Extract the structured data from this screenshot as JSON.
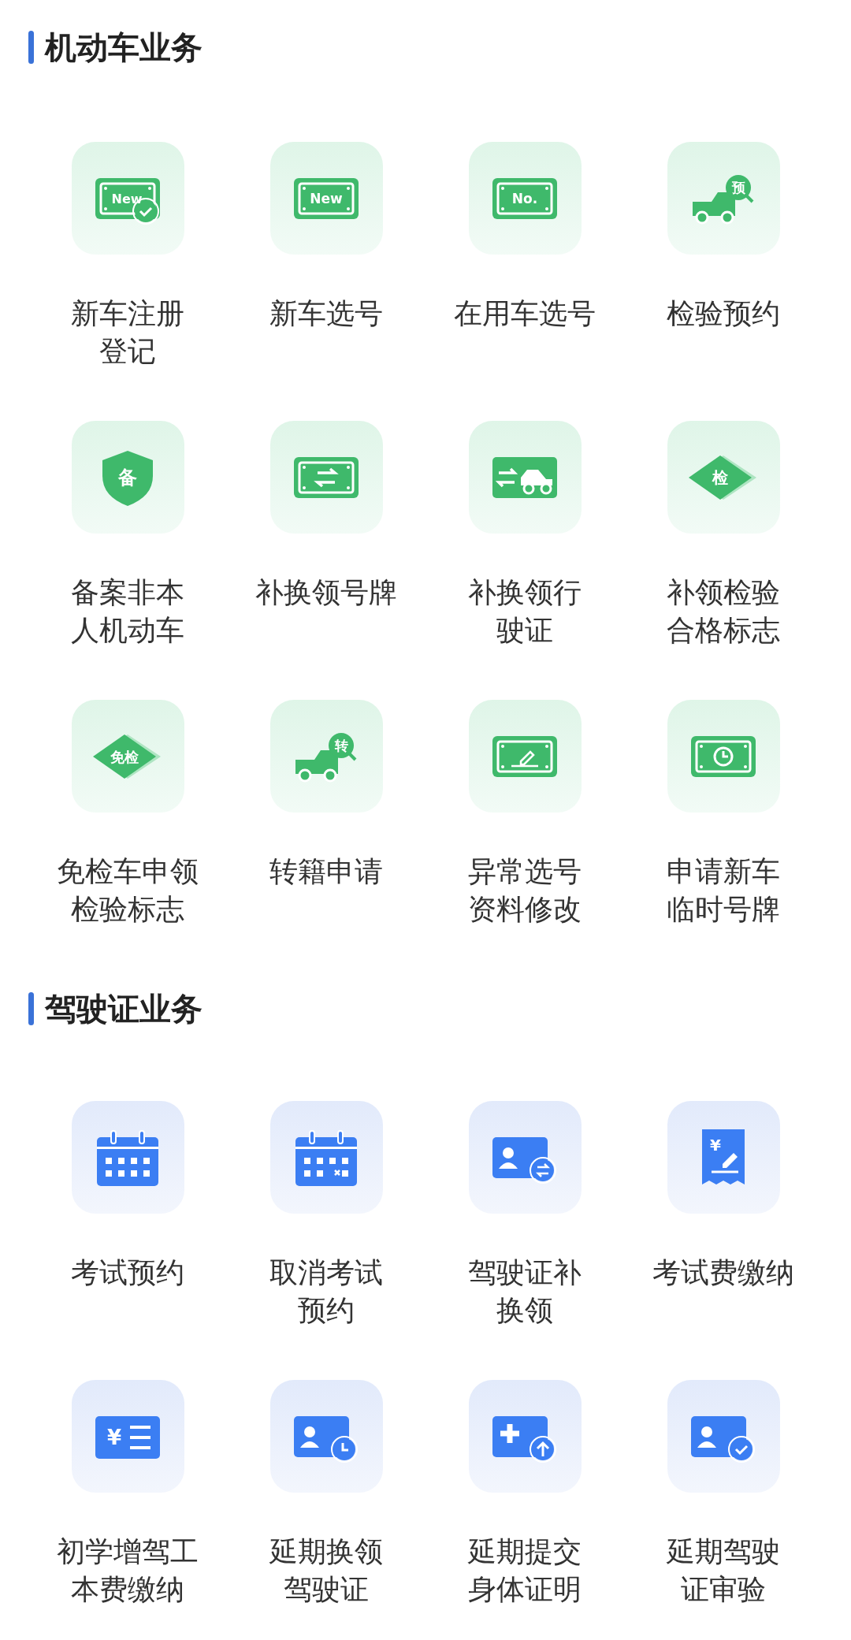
{
  "sections": [
    {
      "title": "机动车业务",
      "kind": "vehicle",
      "items": [
        {
          "lines": [
            "新车注册",
            "登记"
          ],
          "kind": "plate-check",
          "icon_text": "New"
        },
        {
          "lines": [
            "新车选号"
          ],
          "kind": "plate",
          "icon_text": "New"
        },
        {
          "lines": [
            "在用车选号"
          ],
          "kind": "plate",
          "icon_text": "No."
        },
        {
          "lines": [
            "检验预约"
          ],
          "kind": "truck",
          "icon_text": "预"
        },
        {
          "lines": [
            "备案非本",
            "人机动车"
          ],
          "kind": "shield",
          "icon_text": "备"
        },
        {
          "lines": [
            "补换领号牌"
          ],
          "kind": "plate-swap"
        },
        {
          "lines": [
            "补换领行",
            "驶证"
          ],
          "kind": "car-swap"
        },
        {
          "lines": [
            "补领检验",
            "合格标志"
          ],
          "kind": "diamond",
          "icon_text": "检"
        },
        {
          "lines": [
            "免检车申领",
            "检验标志"
          ],
          "kind": "diamond",
          "icon_text": "免检"
        },
        {
          "lines": [
            "转籍申请"
          ],
          "kind": "truck",
          "icon_text": "转"
        },
        {
          "lines": [
            "异常选号",
            "资料修改"
          ],
          "kind": "plate-pen"
        },
        {
          "lines": [
            "申请新车",
            "临时号牌"
          ],
          "kind": "plate-clock"
        }
      ]
    },
    {
      "title": "驾驶证业务",
      "kind": "license",
      "items": [
        {
          "lines": [
            "考试预约"
          ],
          "kind": "calendar"
        },
        {
          "lines": [
            "取消考试",
            "预约"
          ],
          "kind": "calendar-x"
        },
        {
          "lines": [
            "驾驶证补",
            "换领"
          ],
          "kind": "id-swap"
        },
        {
          "lines": [
            "考试费缴纳"
          ],
          "kind": "receipt",
          "icon_text": "¥"
        },
        {
          "lines": [
            "初学增驾工",
            "本费缴纳"
          ],
          "kind": "fee",
          "icon_text": "¥"
        },
        {
          "lines": [
            "延期换领",
            "驾驶证"
          ],
          "kind": "id-clock"
        },
        {
          "lines": [
            "延期提交",
            "身体证明"
          ],
          "kind": "id-up"
        },
        {
          "lines": [
            "延期驾驶",
            "证审验"
          ],
          "kind": "id-check"
        }
      ]
    }
  ]
}
